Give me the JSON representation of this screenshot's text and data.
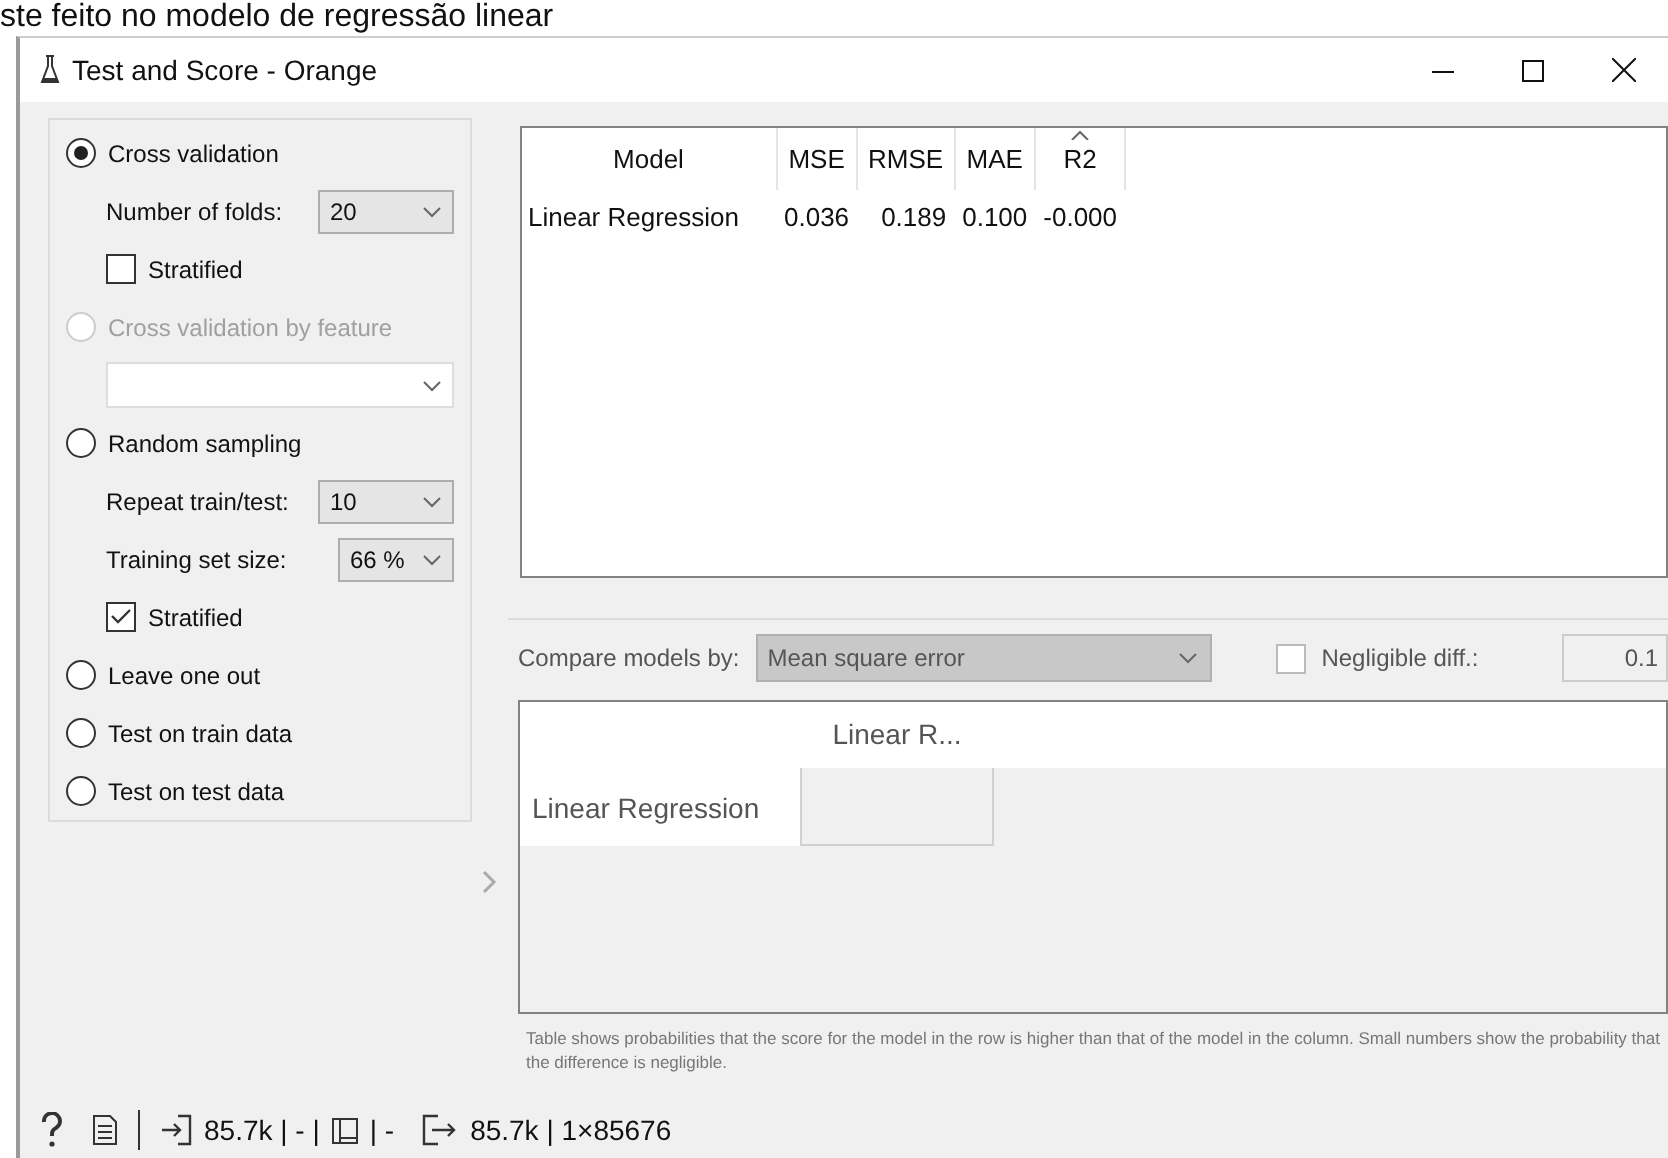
{
  "caption": "ste feito no modelo de regressão linear",
  "window": {
    "title": "Test and Score - Orange"
  },
  "sampling": [
    {
      "kind": "radio",
      "label": "Cross validation",
      "selected": true,
      "disabled": false
    },
    {
      "kind": "select",
      "label": "Number of folds:",
      "value": "20",
      "disabled": false
    },
    {
      "kind": "checkbox",
      "label": "Stratified",
      "checked": false
    },
    {
      "kind": "radio",
      "label": "Cross validation by feature",
      "selected": false,
      "disabled": true
    },
    {
      "kind": "select",
      "disabled": true
    },
    {
      "kind": "radio",
      "label": "Random sampling",
      "selected": false,
      "disabled": false
    },
    {
      "kind": "select",
      "label": "Repeat train/test:",
      "value": "10",
      "disabled": false
    },
    {
      "kind": "select",
      "label": "Training set size:",
      "value": "66 %",
      "disabled": false
    },
    {
      "kind": "checkbox",
      "label": "Stratified",
      "checked": true
    },
    {
      "kind": "radio",
      "label": "Leave one out",
      "selected": false,
      "disabled": false
    },
    {
      "kind": "radio",
      "label": "Test on train data",
      "selected": false,
      "disabled": false
    },
    {
      "kind": "radio",
      "label": "Test on test data",
      "selected": false,
      "disabled": false
    }
  ],
  "scores": {
    "columns": [
      {
        "label": "Model",
        "sorted": false
      },
      {
        "label": "MSE",
        "sorted": false
      },
      {
        "label": "RMSE",
        "sorted": false
      },
      {
        "label": "MAE",
        "sorted": false
      },
      {
        "label": "R2",
        "sorted": true
      }
    ],
    "rows": [
      [
        "Linear Regression",
        "0.036",
        "0.189",
        "0.100",
        "-0.000"
      ]
    ]
  },
  "compare": {
    "label": "Compare models by:",
    "value": "Mean square error",
    "disabled": true,
    "negligible": {
      "label": "Negligible diff.:",
      "checked": false,
      "value": "0.1"
    },
    "column_headers": [
      "Linear R..."
    ],
    "row_headers": [
      "Linear Regression"
    ],
    "note": "Table shows probabilities that the score for the model in the row is higher than that of the model in the column. Small numbers show the probability that the difference is negligible."
  },
  "status_bar": {
    "input": "85.7k | - |",
    "middle": "| -",
    "output": "85.7k | 1×85676"
  }
}
